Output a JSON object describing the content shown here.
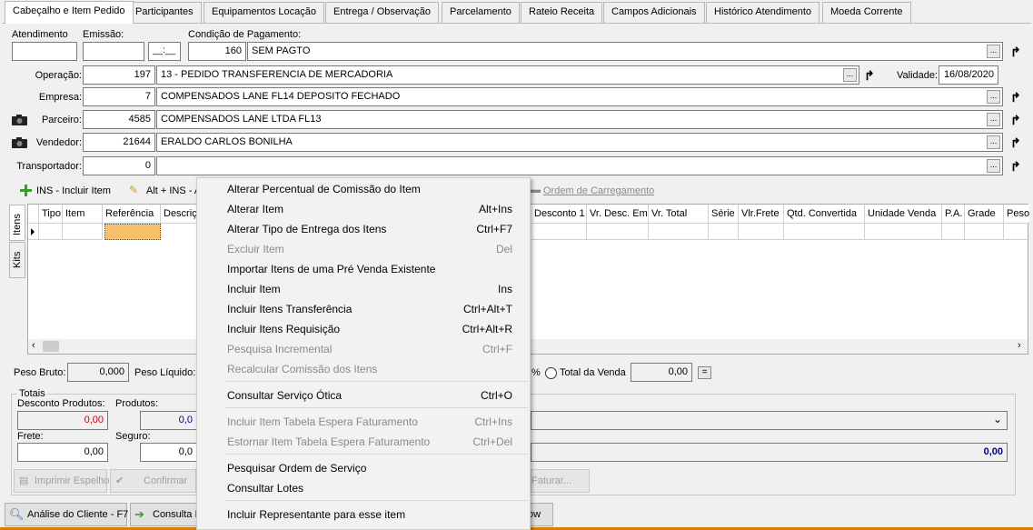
{
  "tabs": [
    "Cabeçalho e Item Pedido",
    "Participantes",
    "Equipamentos Locação",
    "Entrega / Observação",
    "Parcelamento",
    "Rateio Receita",
    "Campos Adicionais",
    "Histórico Atendimento",
    "Moeda Corrente"
  ],
  "header": {
    "atendimento_label": "Atendimento",
    "emissao_label": "Emissão:",
    "emissao_time": "__:__",
    "condicao_label": "Condição de Pagamento:",
    "condicao_code": "160",
    "condicao_desc": "SEM PAGTO",
    "operacao_label": "Operação:",
    "operacao_code": "197",
    "operacao_desc": "13 - PEDIDO TRANSFERENCIA DE MERCADORIA",
    "validade_label": "Validade:",
    "validade_value": "16/08/2020",
    "empresa_label": "Empresa:",
    "empresa_code": "7",
    "empresa_desc": "COMPENSADOS LANE FL14 DEPOSITO FECHADO",
    "parceiro_label": "Parceiro:",
    "parceiro_code": "4585",
    "parceiro_desc": "COMPENSADOS LANE LTDA FL13",
    "vendedor_label": "Vendedor:",
    "vendedor_code": "21644",
    "vendedor_desc": "ERALDO CARLOS BONILHA",
    "transportador_label": "Transportador:",
    "transportador_code": "0",
    "dots": "..."
  },
  "toolbar": {
    "incluir": "INS - Incluir Item",
    "alt_ins": "Alt + INS - A",
    "ordem": "Ordem de Carregamento"
  },
  "side_tabs": [
    "Itens",
    "Kits"
  ],
  "grid_columns": [
    "Tipo",
    "Item",
    "Referência",
    "Descriç",
    "Desconto 1",
    "Vr. Desc. Em",
    "Vr. Total",
    "Série",
    "Vlr.Frete",
    "Qtd. Convertida",
    "Unidade Venda",
    "P.A.",
    "Grade",
    "Peso"
  ],
  "weights": {
    "peso_bruto_label": "Peso Bruto:",
    "peso_bruto_value": "0,000",
    "peso_liquido_label": "Peso Líquido:",
    "pct": "%",
    "total_venda_label": "Total da Venda",
    "total_venda_value": "0,00",
    "eq": "="
  },
  "totais": {
    "title": "Totais",
    "desconto_label": "Desconto Produtos:",
    "desconto_value": "0,00",
    "produtos_label": "Produtos:",
    "produtos_value": "0,0",
    "frete_label": "Frete:",
    "frete_value": "0,00",
    "seguro_label": "Seguro:",
    "seguro_value": "0,0",
    "right_total": "0,00"
  },
  "buttons": {
    "imprimir": "Imprimir Espelho",
    "confirmar": "Confirmar",
    "faturar": "Faturar...",
    "analise": "Análise do Cliente - F7",
    "consulta": "Consulta I",
    "ow": "ow"
  },
  "context_menu": [
    {
      "label": "Alterar Percentual de Comissão do Item",
      "shortcut": "",
      "enabled": true
    },
    {
      "label": "Alterar Item",
      "shortcut": "Alt+Ins",
      "enabled": true
    },
    {
      "label": "Alterar Tipo de Entrega dos Itens",
      "shortcut": "Ctrl+F7",
      "enabled": true
    },
    {
      "label": "Excluir Item",
      "shortcut": "Del",
      "enabled": false
    },
    {
      "label": "Importar Itens de uma Pré Venda Existente",
      "shortcut": "",
      "enabled": true
    },
    {
      "label": "Incluir Item",
      "shortcut": "Ins",
      "enabled": true
    },
    {
      "label": "Incluir Itens Transferência",
      "shortcut": "Ctrl+Alt+T",
      "enabled": true
    },
    {
      "label": "Incluir Itens Requisição",
      "shortcut": "Ctrl+Alt+R",
      "enabled": true
    },
    {
      "label": "Pesquisa Incremental",
      "shortcut": "Ctrl+F",
      "enabled": false
    },
    {
      "label": "Recalcular Comissão dos Itens",
      "shortcut": "",
      "enabled": false
    },
    {
      "label": "Consultar Serviço Ótica",
      "shortcut": "Ctrl+O",
      "enabled": true
    },
    {
      "label": "Incluir Item Tabela Espera Faturamento",
      "shortcut": "Ctrl+Ins",
      "enabled": false
    },
    {
      "label": "Estornar Item Tabela Espera Faturamento",
      "shortcut": "Ctrl+Del",
      "enabled": false
    },
    {
      "label": "Pesquisar Ordem de Serviço",
      "shortcut": "",
      "enabled": true
    },
    {
      "label": "Consultar Lotes",
      "shortcut": "",
      "enabled": true
    },
    {
      "label": "Incluir Representante para esse item",
      "shortcut": "",
      "enabled": true
    }
  ],
  "colors": {
    "red_value": "#cc0000",
    "blue_value": "#000080",
    "selected_cell": "#f7c26b"
  }
}
